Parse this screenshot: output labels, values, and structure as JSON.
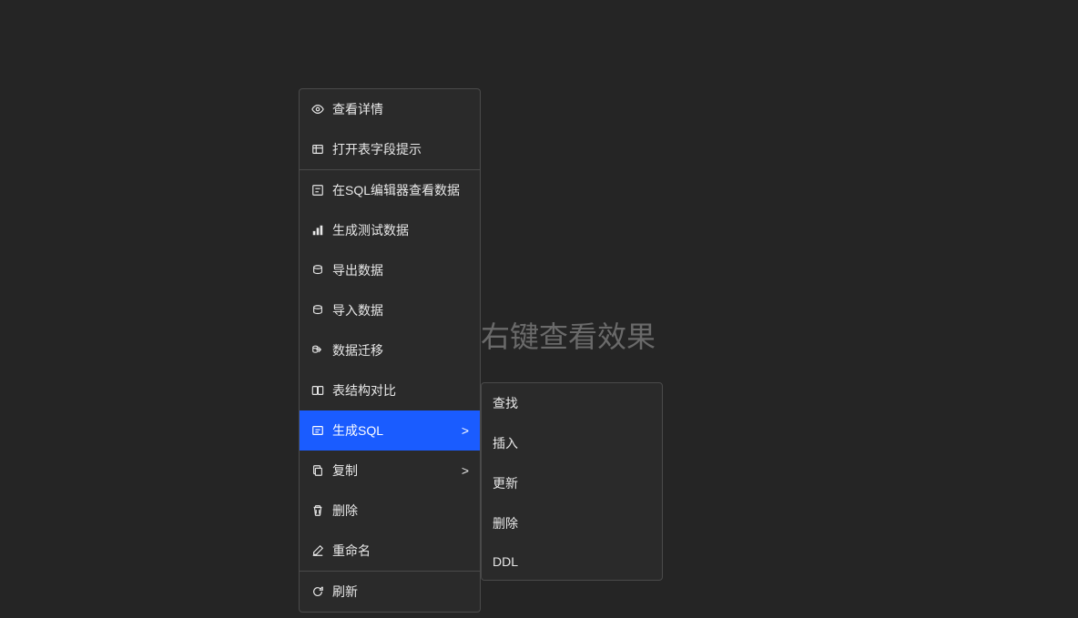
{
  "background_text": "点击右键查看效果",
  "menu": {
    "items": [
      {
        "icon": "eye",
        "label": "查看详情"
      },
      {
        "icon": "table",
        "label": "打开表字段提示"
      }
    ],
    "items2": [
      {
        "icon": "sql",
        "label": "在SQL编辑器查看数据"
      },
      {
        "icon": "bar-chart",
        "label": "生成测试数据"
      },
      {
        "icon": "export",
        "label": "导出数据"
      },
      {
        "icon": "import",
        "label": "导入数据"
      },
      {
        "icon": "migrate",
        "label": "数据迁移"
      },
      {
        "icon": "compare",
        "label": "表结构对比"
      },
      {
        "icon": "generate",
        "label": "生成SQL",
        "hasSubmenu": true,
        "highlighted": true
      },
      {
        "icon": "copy",
        "label": "复制",
        "hasSubmenu": true
      },
      {
        "icon": "trash",
        "label": "删除"
      },
      {
        "icon": "edit",
        "label": "重命名"
      }
    ],
    "items3": [
      {
        "icon": "refresh",
        "label": "刷新"
      }
    ]
  },
  "submenu": {
    "items": [
      {
        "label": "查找"
      },
      {
        "label": "插入"
      },
      {
        "label": "更新"
      },
      {
        "label": "删除"
      },
      {
        "label": "DDL"
      }
    ]
  },
  "arrow": ">"
}
